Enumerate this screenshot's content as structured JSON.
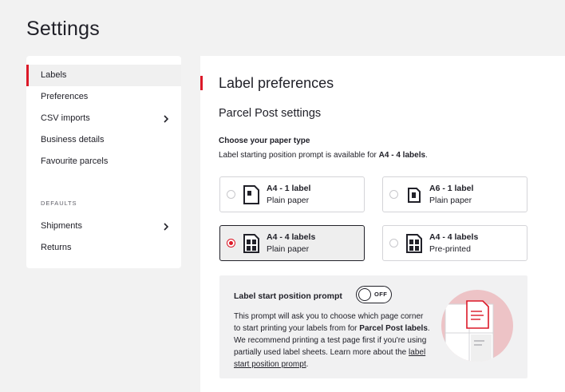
{
  "page": {
    "title": "Settings"
  },
  "sidebar": {
    "items": [
      {
        "label": "Labels",
        "active": true,
        "has_chevron": false
      },
      {
        "label": "Preferences",
        "active": false,
        "has_chevron": false
      },
      {
        "label": "CSV imports",
        "active": false,
        "has_chevron": true
      },
      {
        "label": "Business details",
        "active": false,
        "has_chevron": false
      },
      {
        "label": "Favourite parcels",
        "active": false,
        "has_chevron": false
      }
    ],
    "defaults_section": {
      "label": "DEFAULTS",
      "items": [
        {
          "label": "Shipments",
          "has_chevron": true
        },
        {
          "label": "Returns",
          "has_chevron": false
        }
      ]
    }
  },
  "main": {
    "title": "Label preferences",
    "section_title": "Parcel Post settings",
    "paper_type": {
      "heading": "Choose your paper type",
      "desc_prefix": "Label starting position prompt is available for ",
      "desc_bold": "A4 - 4 labels",
      "desc_suffix": ".",
      "options": [
        {
          "title": "A4 - 1 label",
          "subtitle": "Plain paper",
          "selected": false,
          "icon": "a4-single-label-icon"
        },
        {
          "title": "A6 - 1 label",
          "subtitle": "Plain paper",
          "selected": false,
          "icon": "a6-single-label-icon"
        },
        {
          "title": "A4 - 4 labels",
          "subtitle": "Plain paper",
          "selected": true,
          "icon": "a4-four-labels-icon"
        },
        {
          "title": "A4 - 4 labels",
          "subtitle": "Pre-printed",
          "selected": false,
          "icon": "a4-four-labels-icon"
        }
      ]
    },
    "prompt": {
      "title": "Label start position prompt",
      "toggle_label": "OFF",
      "toggle_on": false,
      "body_1": "This prompt will ask you to choose which page corner to start printing your labels from for ",
      "body_bold": "Parcel Post labels",
      "body_2": ". We recommend printing a test page first if you're using partially used label sheets. Learn more about the ",
      "link_text": "label start position prompt",
      "body_end": "."
    }
  },
  "colors": {
    "accent": "#dc1928",
    "background": "#f2f2f2",
    "text": "#212129",
    "panel": "#f1f1f2"
  }
}
